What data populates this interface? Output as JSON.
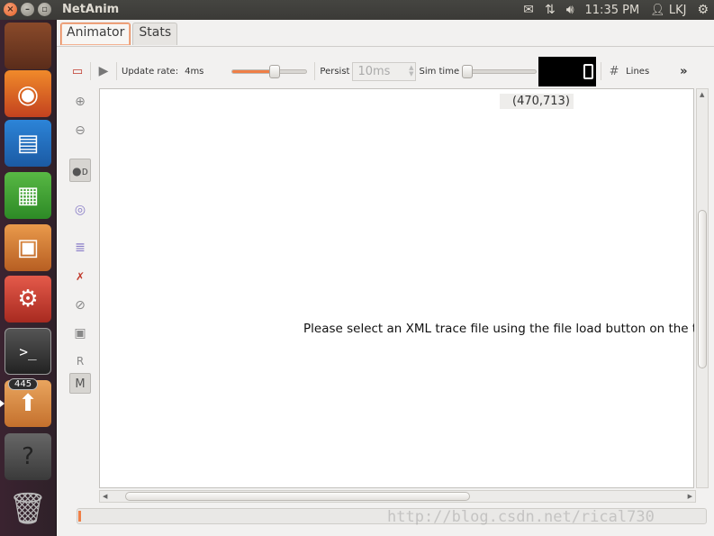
{
  "top_bar": {
    "app_name": "NetAnim",
    "clock": "11:35 PM",
    "user": "LKJ",
    "icons": [
      "close-icon",
      "minimize-icon",
      "maximize-icon",
      "mail-icon",
      "network-icon",
      "volume-icon",
      "user-icon",
      "settings-gear-icon"
    ]
  },
  "launcher": {
    "items": [
      {
        "name": "files-app-icon"
      },
      {
        "name": "firefox-icon"
      },
      {
        "name": "writer-icon"
      },
      {
        "name": "calc-icon"
      },
      {
        "name": "impress-icon"
      },
      {
        "name": "system-settings-icon"
      },
      {
        "name": "terminal-icon"
      },
      {
        "name": "software-updater-icon",
        "badge": "445"
      },
      {
        "name": "help-icon"
      },
      {
        "name": "trash-icon"
      }
    ]
  },
  "tabs": [
    {
      "label": "Animator",
      "active": true
    },
    {
      "label": "Stats",
      "active": false
    }
  ],
  "toolbar": {
    "update_rate_label": "Update rate:",
    "update_rate_value": "4ms",
    "persist_label": "Persist",
    "persist_value": "10ms",
    "sim_time_label": "Sim time",
    "lines_label": "Lines",
    "more_label": "»",
    "update_rate_slider_fraction": 0.55
  },
  "side_tools": {
    "R_label": "R",
    "M_label": "M"
  },
  "canvas": {
    "coordinates": "(470,713)",
    "message": "Please select an XML trace file using the file load button on the top-left corner"
  },
  "watermark": "http://blog.csdn.net/rical730",
  "colors": {
    "accent": "#ef7f47",
    "top_bar": "#3c3b37"
  }
}
